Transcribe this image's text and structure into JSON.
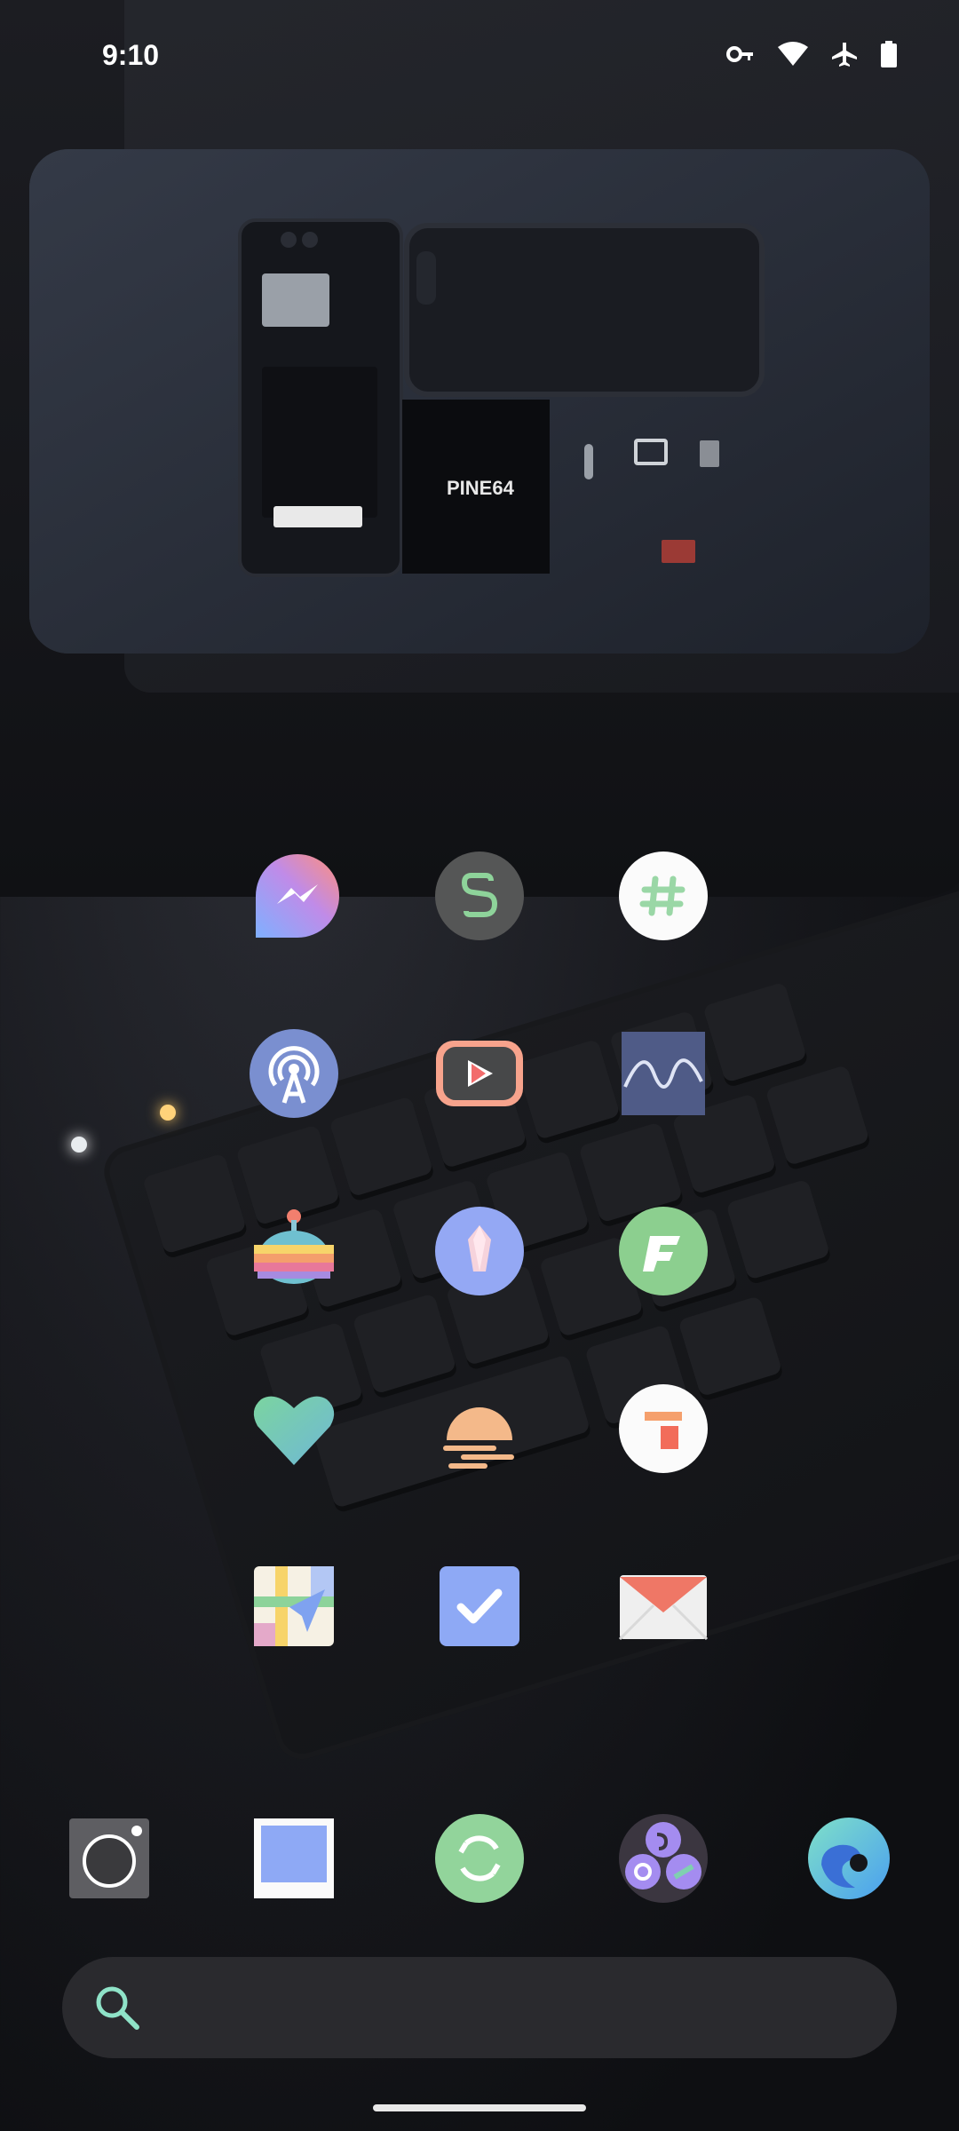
{
  "status_bar": {
    "time": "9:10",
    "icons": [
      "vpn-key-icon",
      "wifi-icon",
      "airplane-mode-icon",
      "battery-icon"
    ]
  },
  "widget": {
    "type": "photo",
    "brand_text": "PINE64"
  },
  "apps": {
    "row1": [
      "messenger-app-icon",
      "signal-like-app-icon",
      "slack-like-app-icon"
    ],
    "row2": [
      "podcast-app-icon",
      "video-player-app-icon",
      "audio-wave-app-icon"
    ],
    "row3": [
      "rainbow-robot-app-icon",
      "crystal-app-icon",
      "f-droid-like-app-icon"
    ],
    "row4": [
      "heart-health-app-icon",
      "sunset-app-icon",
      "g-slides-app-icon"
    ],
    "row5": [
      "maps-app-icon",
      "tasks-app-icon",
      "mail-app-icon"
    ]
  },
  "dock": [
    "camera-app-icon",
    "gallery-app-icon",
    "sync-app-icon",
    "folder-app-icon",
    "edge-browser-app-icon"
  ],
  "search": {
    "placeholder": ""
  },
  "colors": {
    "accent_search": "#8fe3c8",
    "search_bg": "#2a2a2e"
  }
}
